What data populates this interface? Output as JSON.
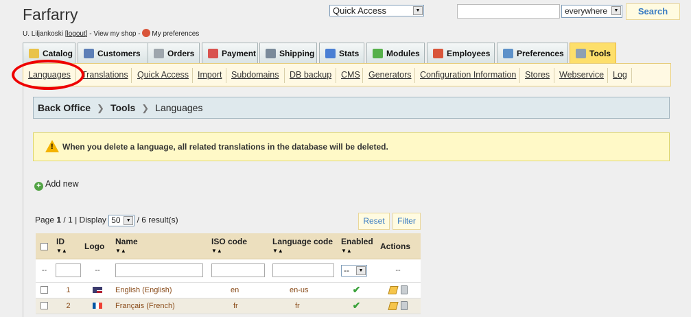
{
  "header": {
    "shop_name": "Farfarry",
    "user_name": "U. Liljankoski",
    "logout_prefix": "[",
    "logout": "logout",
    "logout_suffix": "] -",
    "view_shop": "View my shop",
    "dash": "-",
    "my_preferences": "My preferences",
    "quick_access": "Quick Access",
    "search_scope": "everywhere",
    "search_button": "Search",
    "search_value": ""
  },
  "tabs": [
    {
      "label": "Catalog",
      "icon": "folder-icon",
      "color": "#e9c34a"
    },
    {
      "label": "Customers",
      "icon": "customers-icon",
      "color": "#5d7fb7"
    },
    {
      "label": "Orders",
      "icon": "cart-icon",
      "color": "#9ea6ad"
    },
    {
      "label": "Payment",
      "icon": "payment-icon",
      "color": "#d9534f"
    },
    {
      "label": "Shipping",
      "icon": "truck-icon",
      "color": "#7a8a9a"
    },
    {
      "label": "Stats",
      "icon": "stats-icon",
      "color": "#4a7fd4"
    },
    {
      "label": "Modules",
      "icon": "puzzle-icon",
      "color": "#56b04a"
    },
    {
      "label": "Employees",
      "icon": "employees-icon",
      "color": "#d9553a"
    },
    {
      "label": "Preferences",
      "icon": "preferences-icon",
      "color": "#5d91c9"
    },
    {
      "label": "Tools",
      "icon": "wrench-icon",
      "color": "#8da0b4"
    }
  ],
  "active_tab": "Tools",
  "subnav": [
    "Languages",
    "Translations",
    "Quick Access",
    "Import",
    "Subdomains",
    "DB backup",
    "CMS",
    "Generators",
    "Configuration Information",
    "Stores",
    "Webservice",
    "Log"
  ],
  "breadcrumb": {
    "items": [
      "Back Office",
      "Tools",
      "Languages"
    ]
  },
  "warning": "When you delete a language, all related translations in the database will be deleted.",
  "add_new": "Add new",
  "pager": {
    "prefix": "Page",
    "page": "1",
    "total_pages": "/ 1",
    "display": "| Display",
    "per_page": "50",
    "results": "/ 6 result(s)"
  },
  "buttons": {
    "reset": "Reset",
    "filter": "Filter"
  },
  "table": {
    "headers": {
      "id": "ID",
      "logo": "Logo",
      "name": "Name",
      "iso": "ISO code",
      "lang": "Language code",
      "enabled": "Enabled",
      "actions": "Actions"
    },
    "filters": {
      "select_dash": "--",
      "logo_dash": "--",
      "actions_dash": "--",
      "enabled_value": "--"
    },
    "rows": [
      {
        "id": "1",
        "name": "English (English)",
        "iso": "en",
        "code": "en-us",
        "enabled": "✔"
      },
      {
        "id": "2",
        "name": "Français (French)",
        "iso": "fr",
        "code": "fr",
        "enabled": "✔"
      }
    ]
  },
  "colors": {
    "active_tab": "#fddf6b",
    "highlight_circle": "#e00000",
    "link_blue": "#3a7cc3"
  }
}
